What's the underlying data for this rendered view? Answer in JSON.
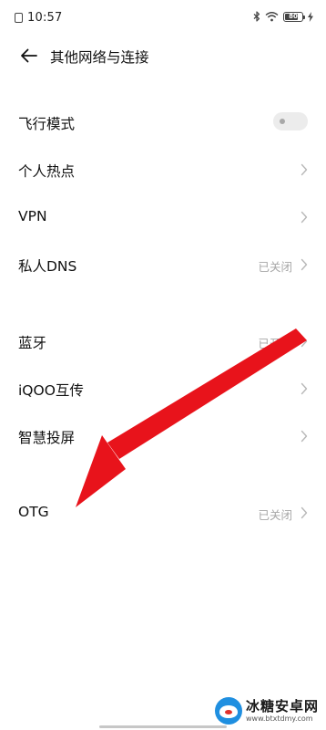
{
  "status_bar": {
    "time": "10:57",
    "battery_level": "80",
    "icons": [
      "notification-app-icon",
      "bluetooth-icon",
      "wifi-icon",
      "battery-icon",
      "charging-bolt-icon"
    ]
  },
  "header": {
    "back_icon": "back-arrow-icon",
    "title": "其他网络与连接"
  },
  "groups": [
    {
      "items": [
        {
          "label": "飞行模式",
          "control": "toggle",
          "toggle_on": false
        },
        {
          "label": "个人热点",
          "control": "chevron"
        },
        {
          "label": "VPN",
          "control": "chevron"
        },
        {
          "label": "私人DNS",
          "value": "已关闭",
          "control": "chevron"
        }
      ]
    },
    {
      "items": [
        {
          "label": "蓝牙",
          "value": "已开启",
          "control": "chevron"
        },
        {
          "label": "iQOO互传",
          "control": "chevron"
        },
        {
          "label": "智慧投屏",
          "control": "chevron"
        }
      ]
    },
    {
      "items": [
        {
          "label": "OTG",
          "value": "已关闭",
          "control": "chevron"
        }
      ]
    }
  ],
  "annotation": {
    "type": "arrow",
    "color": "#e8131b"
  },
  "watermark": {
    "name": "冰糖安卓网",
    "url": "www.btxtdmy.com"
  },
  "colors": {
    "text": "#111111",
    "secondary": "#a6a6a6",
    "arrow": "#e8131b",
    "toggle_bg": "#ececec"
  }
}
